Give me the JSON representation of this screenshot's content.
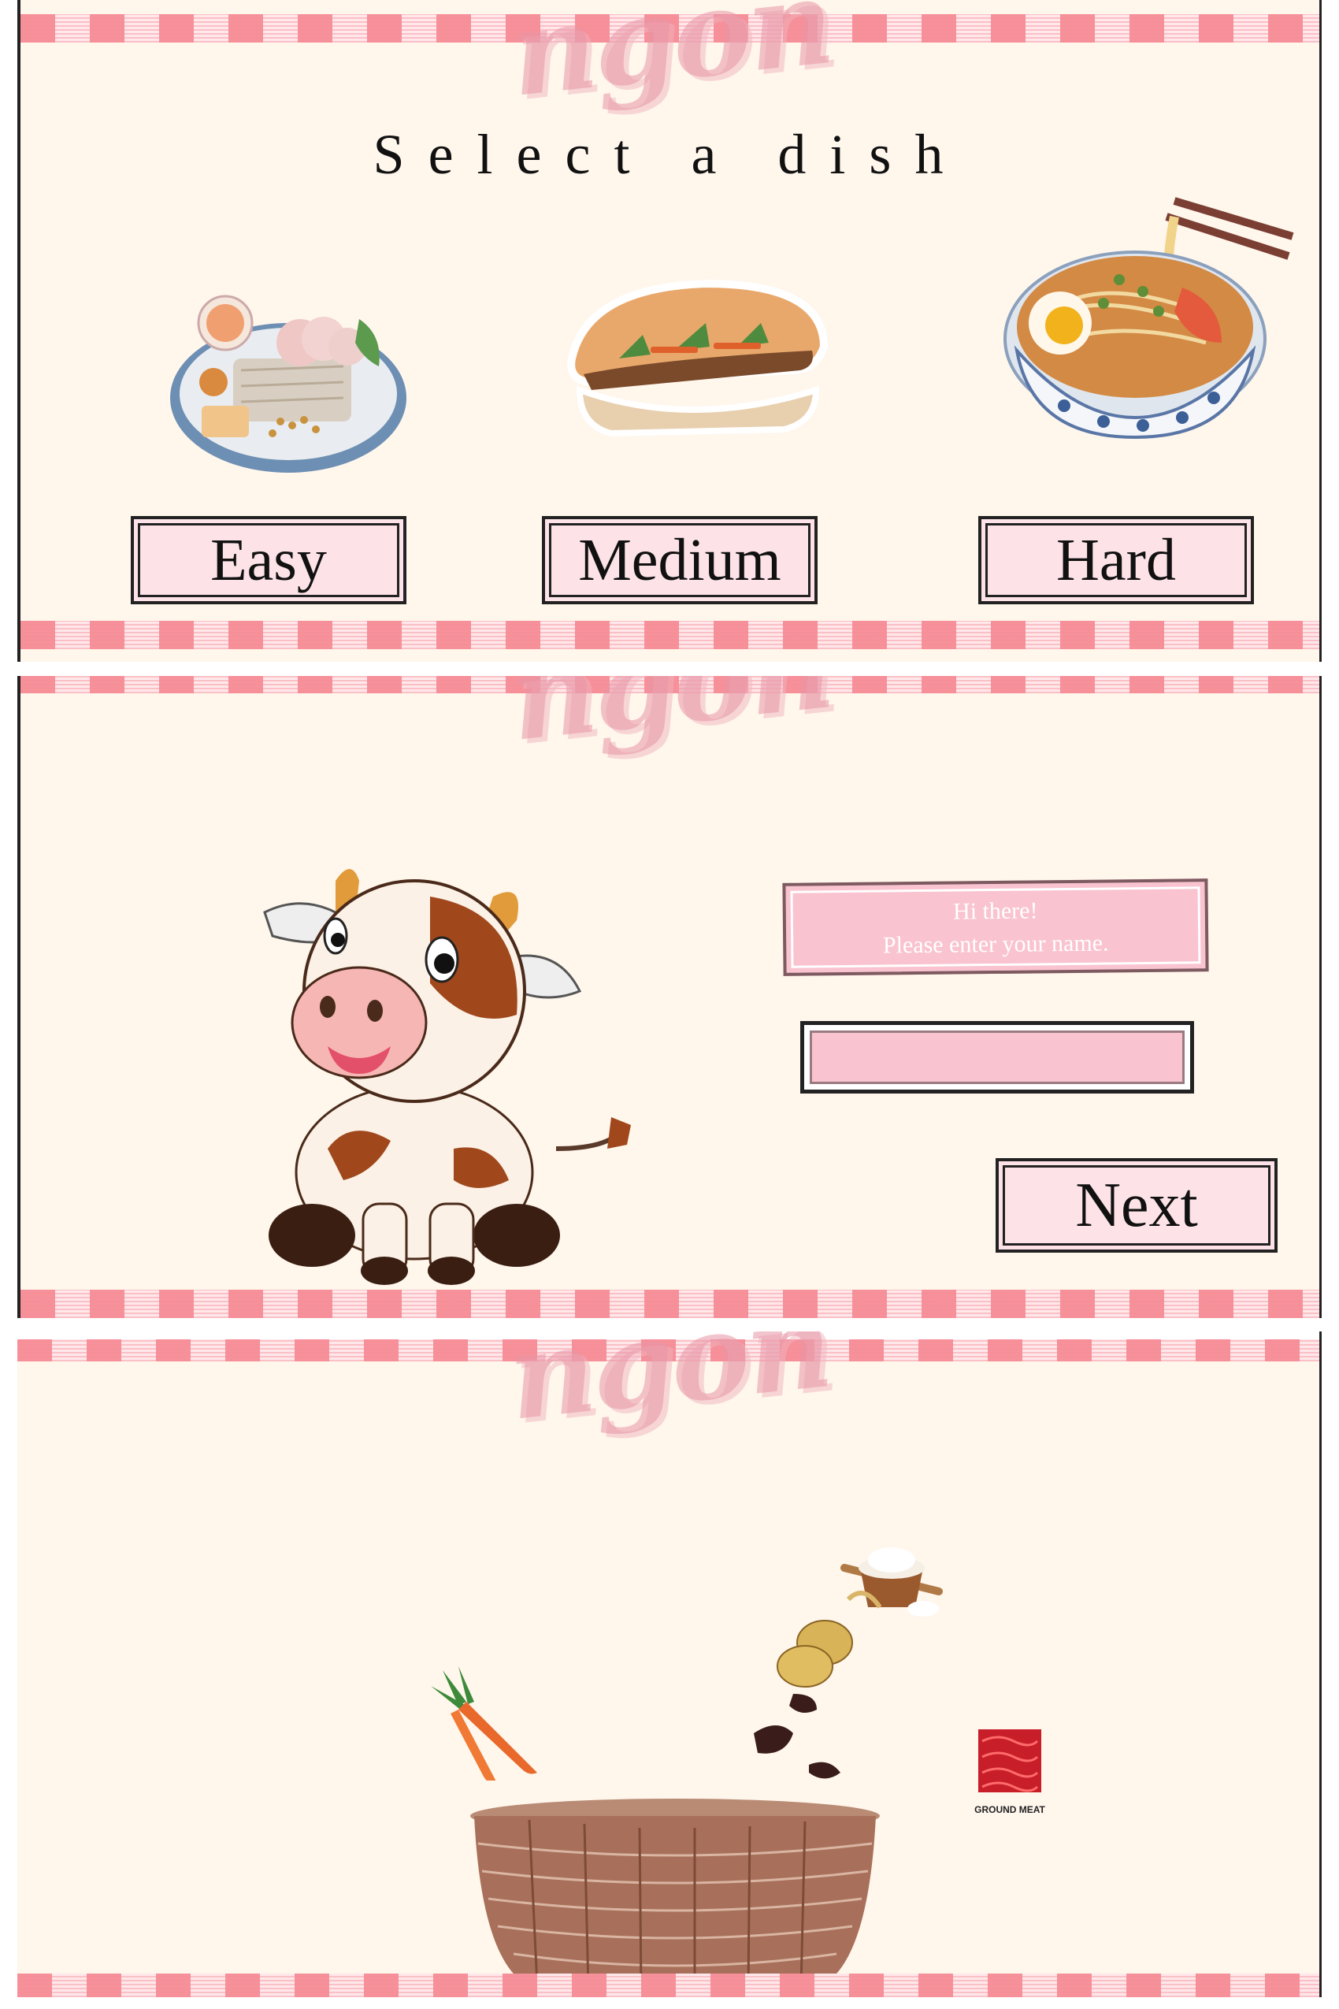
{
  "brand": {
    "logo_text": "ngon"
  },
  "screen1": {
    "title": "Select a dish",
    "dishes": [
      {
        "name": "rice-roll-platter",
        "difficulty": "Easy"
      },
      {
        "name": "banh-mi",
        "difficulty": "Medium"
      },
      {
        "name": "noodle-soup",
        "difficulty": "Hard"
      }
    ]
  },
  "screen2": {
    "greeting_line1": "Hi there!",
    "greeting_line2": "Please enter your name.",
    "name_value": "",
    "next_label": "Next",
    "mascot": "cow-icon"
  },
  "screen3": {
    "ingredients": [
      "carrot-icon",
      "dried-mushroom-icon",
      "potato-icon",
      "flour-icon",
      "ground-meat-icon"
    ],
    "ground_meat_label": "GROUND MEAT",
    "basket": "basket-icon"
  },
  "colors": {
    "background": "#fff6ec",
    "button_pink": "#fde3e7",
    "accent_pink": "#f68c96",
    "ink": "#111111"
  }
}
